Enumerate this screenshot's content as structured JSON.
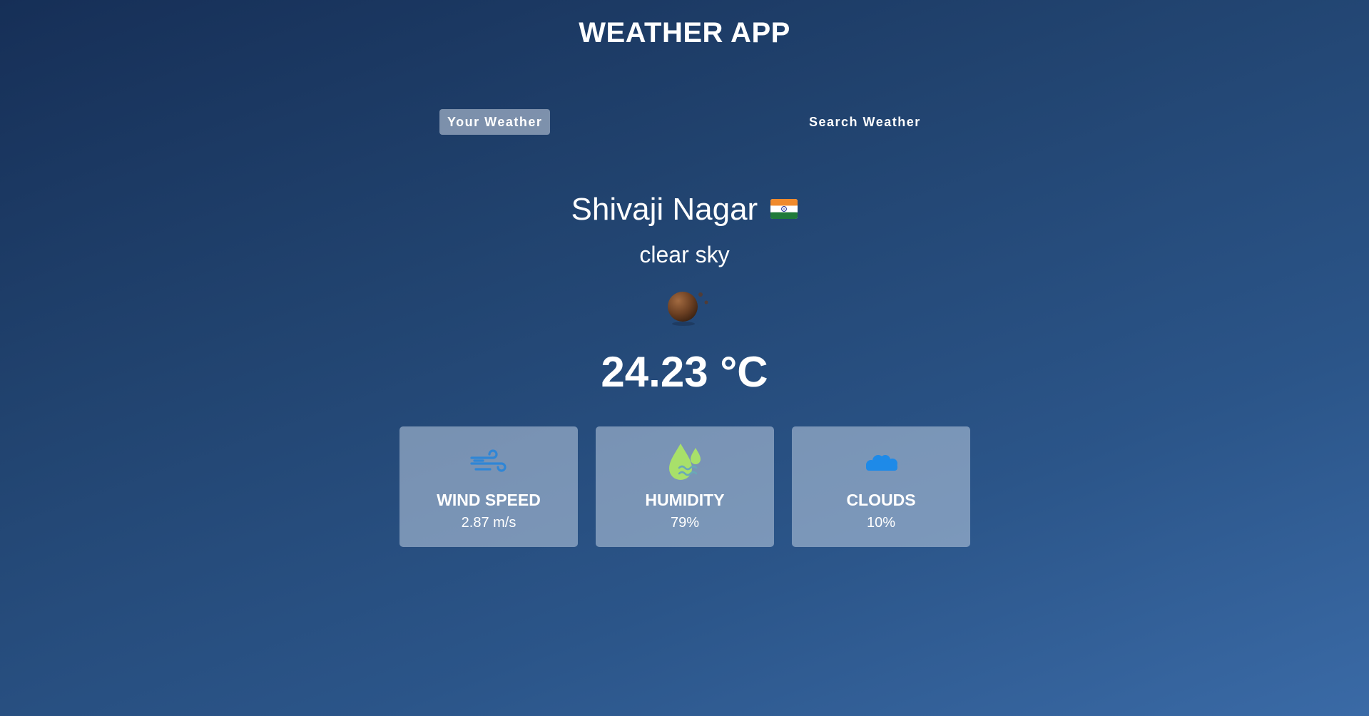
{
  "app": {
    "title": "WEATHER APP"
  },
  "tabs": [
    {
      "label": "Your Weather",
      "active": true
    },
    {
      "label": "Search Weather",
      "active": false
    }
  ],
  "weather": {
    "city": "Shivaji Nagar",
    "country_flag_icon": "india-flag-icon",
    "description": "clear sky",
    "icon": "clear-sky-night-icon",
    "temperature": "24.23 °C"
  },
  "stats": [
    {
      "title": "WIND SPEED",
      "value": "2.87 m/s",
      "icon": "wind-icon"
    },
    {
      "title": "HUMIDITY",
      "value": "79%",
      "icon": "humidity-icon"
    },
    {
      "title": "CLOUDS",
      "value": "10%",
      "icon": "cloud-icon"
    }
  ],
  "colors": {
    "background_start": "#162f57",
    "background_end": "#3a6aa6",
    "card_background": "#8a9fbf",
    "wind_icon": "#2f86d6",
    "humidity_icon": "#a8e06a",
    "cloud_icon": "#1e8ae8"
  }
}
